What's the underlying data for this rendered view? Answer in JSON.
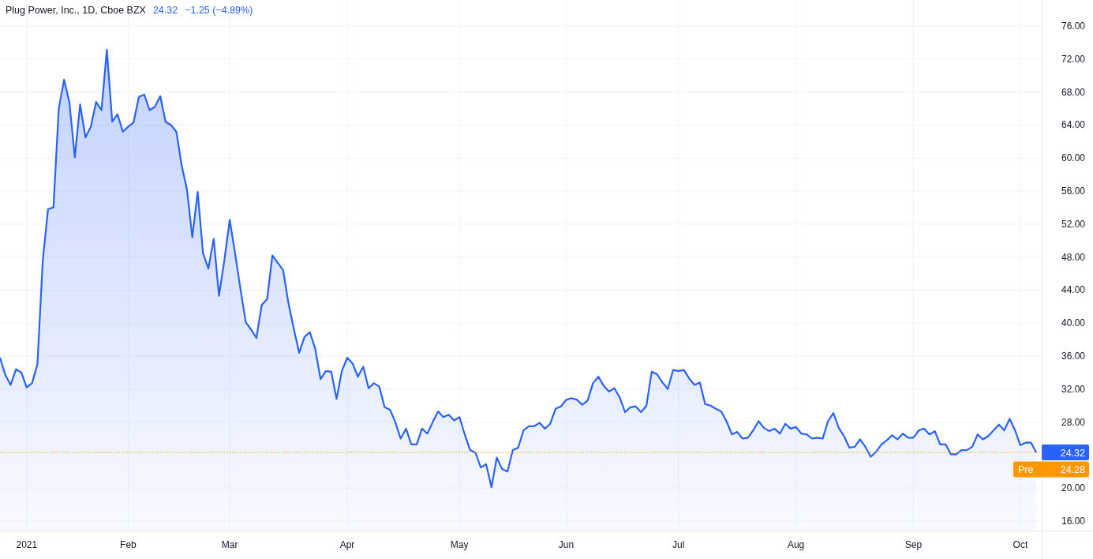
{
  "legend": {
    "symbol": "Plug Power, Inc., 1D, Cboe BZX",
    "price": "24.32",
    "change": "−1.25 (−4.89%)"
  },
  "chart_data": {
    "type": "area",
    "grid": true,
    "ylim": [
      14.85,
      79.15
    ],
    "ref_lines": [
      {
        "axis": "y",
        "value": 24.32,
        "color": "#ff9800"
      }
    ],
    "yticks": [
      {
        "value": 16,
        "label": "16.00"
      },
      {
        "value": 20,
        "label": "20.00"
      },
      {
        "value": 28,
        "label": "28.00"
      },
      {
        "value": 32,
        "label": "32.00"
      },
      {
        "value": 36,
        "label": "36.00"
      },
      {
        "value": 40,
        "label": "40.00"
      },
      {
        "value": 44,
        "label": "44.00"
      },
      {
        "value": 48,
        "label": "48.00"
      },
      {
        "value": 52,
        "label": "52.00"
      },
      {
        "value": 56,
        "label": "56.00"
      },
      {
        "value": 60,
        "label": "60.00"
      },
      {
        "value": 64,
        "label": "64.00"
      },
      {
        "value": 68,
        "label": "68.00"
      },
      {
        "value": 72,
        "label": "72.00"
      },
      {
        "value": 76,
        "label": "76.00"
      }
    ],
    "categories": [
      null,
      null,
      null,
      null,
      null,
      "2021",
      null,
      null,
      null,
      null,
      null,
      null,
      null,
      null,
      null,
      null,
      null,
      null,
      null,
      null,
      null,
      null,
      null,
      null,
      "Feb",
      null,
      null,
      null,
      null,
      null,
      null,
      null,
      null,
      null,
      null,
      null,
      null,
      null,
      null,
      null,
      null,
      null,
      null,
      "Mar",
      null,
      null,
      null,
      null,
      null,
      null,
      null,
      null,
      null,
      null,
      null,
      null,
      null,
      null,
      null,
      null,
      null,
      null,
      null,
      null,
      null,
      "Apr",
      null,
      null,
      null,
      null,
      null,
      null,
      null,
      null,
      null,
      null,
      null,
      null,
      null,
      null,
      null,
      null,
      null,
      null,
      null,
      null,
      "May",
      null,
      null,
      null,
      null,
      null,
      null,
      null,
      null,
      null,
      null,
      null,
      null,
      null,
      null,
      null,
      null,
      null,
      null,
      null,
      "Jun",
      null,
      null,
      null,
      null,
      null,
      null,
      null,
      null,
      null,
      null,
      null,
      null,
      null,
      null,
      null,
      null,
      null,
      null,
      null,
      null,
      "Jul",
      null,
      null,
      null,
      null,
      null,
      null,
      null,
      null,
      null,
      null,
      null,
      null,
      null,
      null,
      null,
      null,
      null,
      null,
      null,
      null,
      null,
      "Aug",
      null,
      null,
      null,
      null,
      null,
      null,
      null,
      null,
      null,
      null,
      null,
      null,
      null,
      null,
      null,
      null,
      null,
      null,
      null,
      null,
      null,
      "Sep",
      null,
      null,
      null,
      null,
      null,
      null,
      null,
      null,
      null,
      null,
      null,
      null,
      null,
      null,
      null,
      null,
      null,
      null,
      null,
      "Oct",
      null,
      null,
      null
    ],
    "series": [
      {
        "color": "#2962ff",
        "values": [
          35.8,
          33.7,
          32.5,
          34.4,
          34.0,
          32.2,
          32.7,
          35.0,
          47.6,
          53.8,
          54.0,
          66.0,
          69.5,
          66.7,
          60.1,
          66.5,
          62.5,
          63.8,
          66.8,
          65.8,
          73.1,
          64.4,
          65.3,
          63.2,
          63.8,
          64.3,
          67.4,
          67.7,
          65.8,
          66.2,
          67.5,
          64.4,
          64.0,
          63.2,
          59.1,
          56.2,
          50.4,
          55.9,
          48.5,
          46.6,
          50.2,
          43.3,
          47.6,
          52.5,
          48.5,
          44.2,
          40.1,
          39.2,
          38.2,
          42.2,
          42.9,
          48.2,
          47.3,
          46.4,
          42.4,
          39.3,
          36.4,
          38.3,
          38.9,
          36.9,
          33.2,
          34.2,
          34.1,
          30.8,
          34.2,
          35.8,
          35.1,
          33.5,
          34.7,
          32.1,
          32.7,
          32.3,
          29.8,
          29.5,
          28.0,
          26.0,
          27.2,
          25.3,
          25.3,
          27.2,
          26.6,
          28.0,
          29.3,
          28.6,
          28.9,
          28.2,
          28.6,
          26.5,
          24.6,
          24.3,
          22.5,
          22.9,
          20.1,
          23.7,
          22.3,
          22.0,
          24.6,
          24.9,
          27.0,
          27.5,
          27.5,
          27.9,
          27.2,
          27.8,
          29.6,
          29.9,
          30.7,
          30.9,
          30.7,
          30.1,
          30.6,
          32.7,
          33.5,
          32.4,
          31.7,
          32.1,
          31.0,
          29.2,
          29.8,
          29.9,
          29.2,
          30.0,
          34.1,
          33.8,
          32.8,
          32.0,
          34.3,
          34.2,
          34.3,
          33.3,
          32.5,
          32.8,
          30.2,
          30.0,
          29.6,
          29.3,
          28.1,
          26.5,
          26.8,
          26.0,
          26.1,
          27.0,
          28.1,
          27.3,
          26.9,
          27.2,
          26.6,
          27.8,
          27.2,
          27.4,
          26.6,
          26.5,
          26.0,
          26.1,
          26.0,
          28.1,
          29.1,
          27.3,
          26.3,
          24.9,
          25.0,
          25.9,
          25.0,
          23.8,
          24.4,
          25.3,
          25.8,
          26.4,
          25.9,
          26.6,
          26.1,
          26.1,
          27.0,
          27.2,
          26.5,
          26.9,
          25.3,
          25.3,
          24.1,
          24.1,
          24.6,
          24.6,
          25.0,
          26.5,
          25.9,
          26.3,
          27.0,
          27.7,
          27.0,
          28.4,
          27.0,
          25.2,
          25.5,
          25.5,
          24.3
        ]
      }
    ]
  },
  "price_tags": [
    {
      "value": "24.32",
      "color": "#2962ff"
    },
    {
      "label": "Pre",
      "value": "24.28",
      "color": "#ff9800"
    }
  ]
}
